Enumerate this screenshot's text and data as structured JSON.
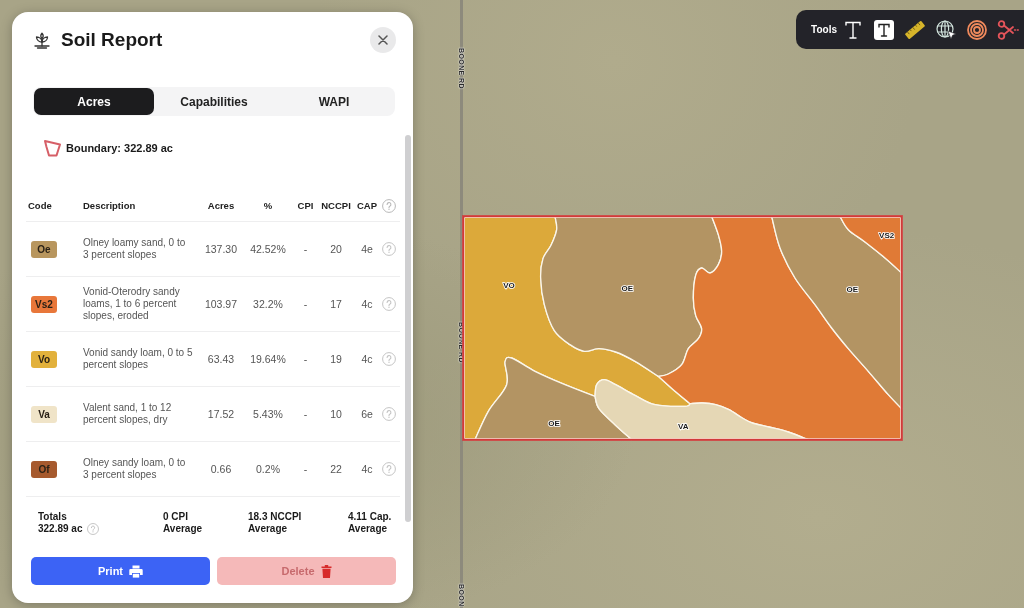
{
  "panel": {
    "title": "Soil Report",
    "tabs": [
      {
        "label": "Acres",
        "selected": true
      },
      {
        "label": "Capabilities",
        "selected": false
      },
      {
        "label": "WAPI",
        "selected": false
      }
    ],
    "boundary": "Boundary: 322.89 ac",
    "table": {
      "columns": [
        "Code",
        "Description",
        "Acres",
        "%",
        "CPI",
        "NCCPI",
        "CAP"
      ],
      "rows": [
        {
          "code": "Oe",
          "color": "#b8965e",
          "description": "Olney loamy sand, 0 to 3 percent slopes",
          "acres": "137.30",
          "percent": "42.52%",
          "cpi": "-",
          "nccpi": "20",
          "cap": "4e"
        },
        {
          "code": "Vs2",
          "color": "#e8773a",
          "description": "Vonid-Oterodry sandy loams, 1 to 6 percent slopes, eroded",
          "acres": "103.97",
          "percent": "32.2%",
          "cpi": "-",
          "nccpi": "17",
          "cap": "4c"
        },
        {
          "code": "Vo",
          "color": "#e2b13c",
          "description": "Vonid sandy loam, 0 to 5 percent slopes",
          "acres": "63.43",
          "percent": "19.64%",
          "cpi": "-",
          "nccpi": "19",
          "cap": "4c"
        },
        {
          "code": "Va",
          "color": "#f0e4c8",
          "description": "Valent sand, 1 to 12 percent slopes, dry",
          "acres": "17.52",
          "percent": "5.43%",
          "cpi": "-",
          "nccpi": "10",
          "cap": "6e"
        },
        {
          "code": "Of",
          "color": "#a65a2e",
          "description": "Olney sandy loam, 0 to 3 percent slopes",
          "acres": "0.66",
          "percent": "0.2%",
          "cpi": "-",
          "nccpi": "22",
          "cap": "4c"
        }
      ]
    },
    "totals": [
      {
        "lines": [
          "Totals",
          "322.89 ac"
        ],
        "help": true
      },
      {
        "lines": [
          "0 CPI",
          "Average"
        ],
        "help": false
      },
      {
        "lines": [
          "18.3 NCCPI",
          "Average"
        ],
        "help": false
      },
      {
        "lines": [
          "4.11 Cap.",
          "Average"
        ],
        "help": false
      }
    ],
    "buttons": [
      {
        "label": "Print",
        "kind": "print"
      },
      {
        "label": "Delete",
        "kind": "delete"
      }
    ]
  },
  "toolbar": {
    "label": "Tools"
  },
  "map": {
    "road_labels": [
      "BOONE RD",
      "BOONE RD",
      "BOON"
    ],
    "soil_zones": [
      {
        "label": "VO",
        "color": "#dca93a"
      },
      {
        "label": "OE",
        "color": "#b39463"
      },
      {
        "color": "#e07a36"
      },
      {
        "label": "OE",
        "color": "#b39463"
      },
      {
        "label": "VS2",
        "color": "#e07a36"
      },
      {
        "label": "OE",
        "color": "#b39463"
      },
      {
        "label": "VA",
        "color": "#e5d7b5"
      }
    ]
  }
}
